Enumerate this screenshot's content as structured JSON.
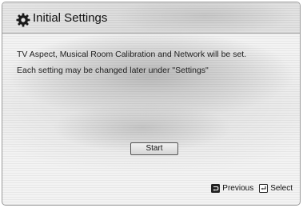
{
  "header": {
    "title": "Initial Settings",
    "icon": "gear-icon"
  },
  "message": {
    "line1": "TV Aspect, Musical Room Calibration and Network will be set.",
    "line2": "Each setting may be changed later under \"Settings\""
  },
  "actions": {
    "start_label": "Start"
  },
  "footer": {
    "previous_label": "Previous",
    "previous_icon": "return-icon",
    "select_label": "Select",
    "select_icon": "enter-icon"
  }
}
